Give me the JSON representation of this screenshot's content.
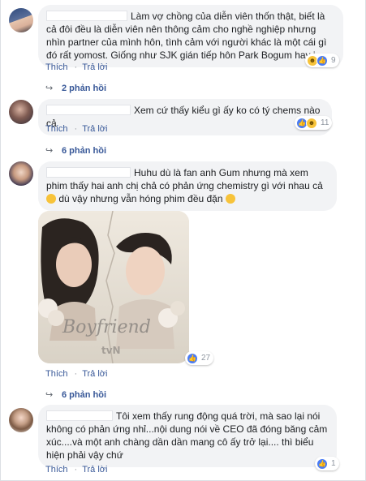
{
  "comments": [
    {
      "text": "Làm vợ chồng của diễn viên thốn thật, biết là cả đôi đều là diễn viên nên thông cảm cho nghề nghiệp nhưng nhìn partner của mình hôn, tình cảm với người khác là một cái gì đó rất yomost. Giống như SJK gián tiếp hôn Park Bogum hay j.",
      "like_label": "Thích",
      "reply_label": "Trả lời",
      "reaction_count": "9",
      "replies": "2 phản hồi"
    },
    {
      "text": "Xem cứ thấy kiểu gì ấy ko có tý chems nào cả",
      "like_label": "Thích",
      "reply_label": "Trả lời",
      "reaction_count": "11",
      "replies": "6 phản hồi"
    },
    {
      "text": "Huhu dù là fan anh Gum nhưng mà xem phim thấy hai anh chị chả có phản ứng chemistry gì với nhau cả",
      "text_tail": "dù vậy nhưng vẫn hóng phim đều đặn",
      "like_label": "Thích",
      "reply_label": "Trả lời",
      "reaction_count": "27",
      "replies": "6 phản hồi",
      "photo": {
        "title_art": "Boyfriend",
        "logo": "tvN"
      }
    },
    {
      "text": "Tôi xem thấy rung động quá trời, mà sao lại nói không có phản ứng nhỉ...nội dung nói về CEO đã đóng băng cảm xúc....và một anh chàng dần dần mang cô ấy trở lại.... thì biểu hiện phải vậy chứ",
      "like_label": "Thích",
      "reply_label": "Trả lời",
      "reaction_count": "1"
    }
  ],
  "colors": {
    "link": "#385898",
    "bubble": "#f2f3f5",
    "like": "#4a7cf5"
  }
}
